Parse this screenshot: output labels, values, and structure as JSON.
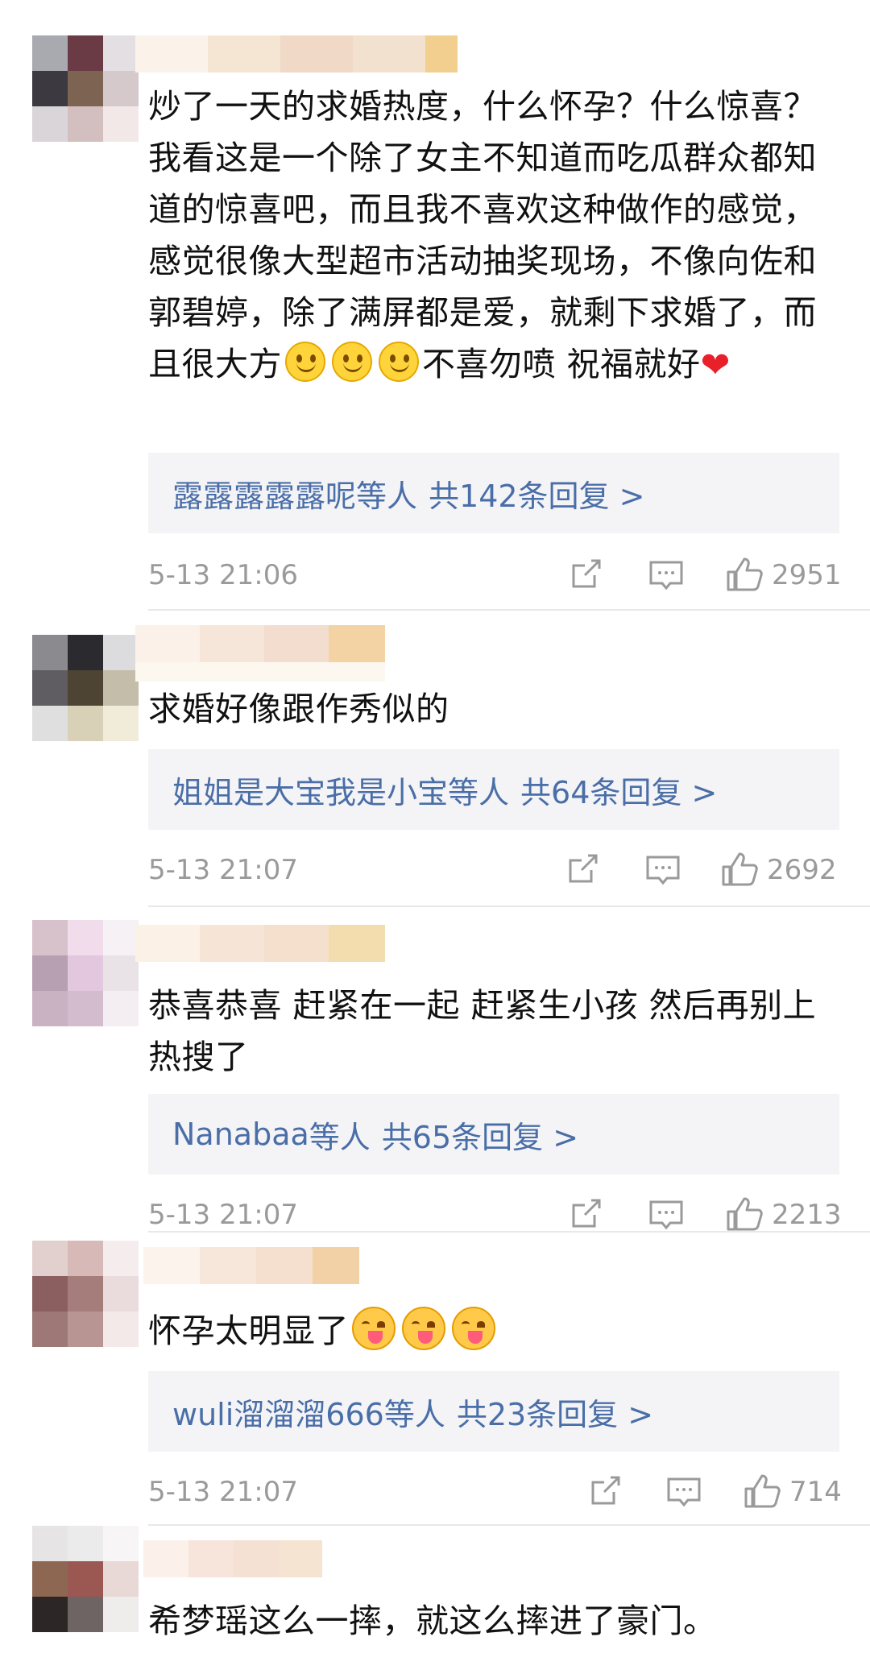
{
  "comments": [
    {
      "text_segments": [
        "炒了一天的求婚热度，什么怀孕？什么惊喜？我看这是一个除了女主不知道而吃瓜群众都知道的惊喜吧，而且我不喜欢这种做作的感觉，感觉很像大型超市活动抽奖现场，不像向佐和郭碧婷，除了满屏都是爱，就剩下求婚了，而且很大方",
        "不喜勿喷 祝福就好"
      ],
      "emojis": [
        "smile-emoji",
        "smile-emoji",
        "smile-emoji",
        "heart-emoji"
      ],
      "reply_names": "露露露露露呢",
      "reply_suffix": "等人",
      "reply_count": "共142条回复 >",
      "time": "5-13 21:06",
      "likes": "2951"
    },
    {
      "text": "求婚好像跟作秀似的",
      "reply_names": "姐姐是大宝我是小宝",
      "reply_suffix": "等人",
      "reply_count": "共64条回复 >",
      "time": "5-13 21:07",
      "likes": "2692"
    },
    {
      "text": "恭喜恭喜 赶紧在一起 赶紧生小孩 然后再别上热搜了",
      "reply_names": "Nanabaa",
      "reply_suffix": "等人",
      "reply_count": "共65条回复 >",
      "time": "5-13 21:07",
      "likes": "2213"
    },
    {
      "text": "怀孕太明显了",
      "emojis": [
        "yum-emoji",
        "yum-emoji",
        "yum-emoji"
      ],
      "reply_names": "wuli溜溜溜666",
      "reply_suffix": "等人",
      "reply_count": "共23条回复 >",
      "time": "5-13 21:07",
      "likes": "714"
    },
    {
      "text": "希梦瑶这么一摔，就这么摔进了豪门。"
    }
  ],
  "icons": {
    "share": "share-icon",
    "comment": "comment-icon",
    "like": "thumbs-up-icon"
  },
  "colors": {
    "reply_link": "#4a6ea8",
    "meta_gray": "#9a9a9a",
    "reply_bg": "#f4f4f6"
  }
}
